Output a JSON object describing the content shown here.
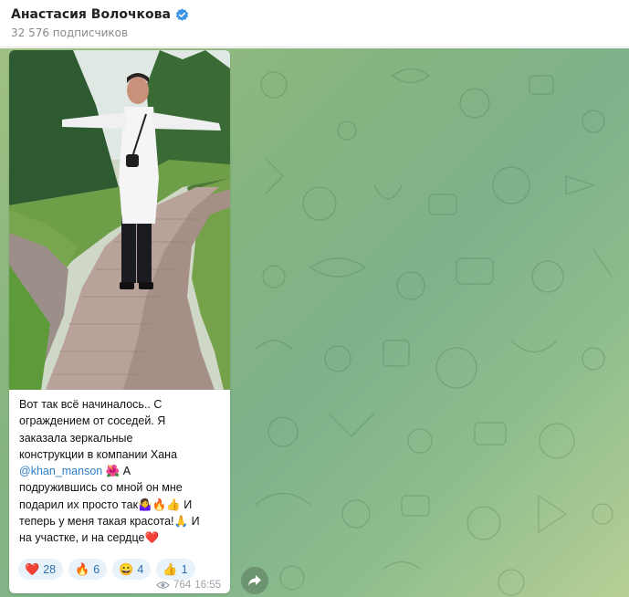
{
  "header": {
    "channel_name": "Анастасия Волочкова",
    "subscribers": "32 576 подписчиков"
  },
  "post": {
    "caption": {
      "line1": "Вот так всё начиналось.. С",
      "line2": "ограждением от соседей. Я",
      "line3": "заказала зеркальные",
      "line4": "конструкции в компании Хана",
      "mention": "@khan_manson",
      "line5_emoji": " 🌺 А",
      "line6": "подружившись со мной он мне",
      "line7": "подарил их просто так🤷‍♀️🔥👍 И",
      "line8": "теперь у меня такая красота!🙏 И",
      "line9": "на участке, и на сердце❤️"
    },
    "reactions": [
      {
        "emoji": "❤️",
        "count": "28"
      },
      {
        "emoji": "🔥",
        "count": "6"
      },
      {
        "emoji": "😀",
        "count": "4"
      },
      {
        "emoji": "👍",
        "count": "1"
      }
    ],
    "views": "764",
    "time": "16:55"
  },
  "colors": {
    "accent": "#2e7fc8",
    "verified": "#3a95e6",
    "reaction_bg": "#e8f2fb"
  },
  "icons": [
    "verified-icon",
    "eye-icon",
    "share-icon"
  ]
}
